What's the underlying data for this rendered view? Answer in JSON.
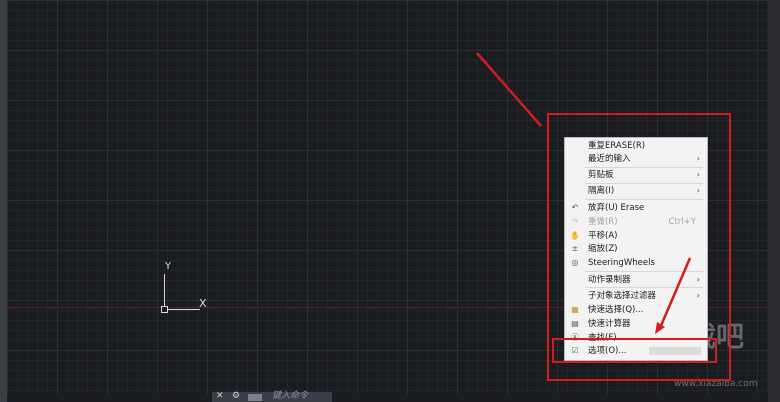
{
  "canvas": {
    "ucs_y_label": "Y",
    "ucs_x_label": "X"
  },
  "context_menu": {
    "items": [
      {
        "label": "重复ERASE(R)",
        "submenu": false,
        "disabled": false,
        "icon": ""
      },
      {
        "label": "最近的输入",
        "submenu": true,
        "disabled": false,
        "icon": ""
      },
      {
        "label": "剪贴板",
        "submenu": true,
        "disabled": false,
        "icon": ""
      },
      {
        "label": "隔离(I)",
        "submenu": true,
        "disabled": false,
        "icon": ""
      },
      {
        "label": "放弃(U) Erase",
        "submenu": false,
        "disabled": false,
        "icon": "undo-icon"
      },
      {
        "label": "重做(R)",
        "submenu": false,
        "disabled": true,
        "icon": "redo-icon",
        "shortcut": "Ctrl+Y"
      },
      {
        "label": "平移(A)",
        "submenu": false,
        "disabled": false,
        "icon": "pan-hand-icon"
      },
      {
        "label": "缩放(Z)",
        "submenu": false,
        "disabled": false,
        "icon": "zoom-icon"
      },
      {
        "label": "SteeringWheels",
        "submenu": false,
        "disabled": false,
        "icon": "steering-wheel-icon"
      },
      {
        "label": "动作录制器",
        "submenu": true,
        "disabled": false,
        "icon": ""
      },
      {
        "label": "子对象选择过滤器",
        "submenu": true,
        "disabled": false,
        "icon": ""
      },
      {
        "label": "快速选择(Q)...",
        "submenu": false,
        "disabled": false,
        "icon": "quick-select-icon"
      },
      {
        "label": "快速计算器",
        "submenu": false,
        "disabled": false,
        "icon": "calculator-icon"
      },
      {
        "label": "查找(F)...",
        "submenu": false,
        "disabled": false,
        "icon": "find-icon"
      },
      {
        "label": "选项(O)...",
        "submenu": false,
        "disabled": false,
        "icon": "options-check-icon"
      }
    ]
  },
  "command_line": {
    "close_glyph": "✕",
    "wrench_glyph": "🔧",
    "prompt": "键入命令"
  },
  "watermark": {
    "text": "下载吧",
    "sub": "www.xiazaiba.com"
  },
  "colors": {
    "annotation_red": "#d01d1d",
    "canvas_bg": "#1a1c20",
    "menu_bg": "#f3f3f3"
  }
}
